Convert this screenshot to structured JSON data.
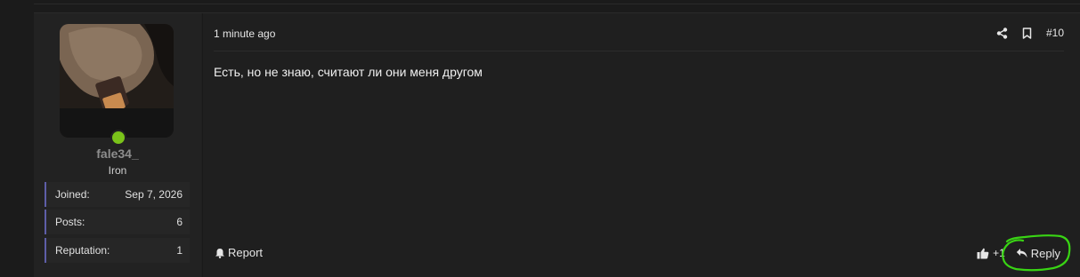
{
  "post": {
    "time": "1 minute ago",
    "number": "#10",
    "message": "Есть, но не знаю, считают ли они меня другом",
    "report_label": "Report",
    "like_count": "+1",
    "reply_label": "Reply"
  },
  "user": {
    "name": "fale34_",
    "rank": "Iron",
    "online_color": "#7ac31a",
    "stats": [
      {
        "label": "Joined:",
        "value": "Sep 7, 2026"
      },
      {
        "label": "Posts:",
        "value": "6"
      },
      {
        "label": "Reputation:",
        "value": "1"
      }
    ]
  },
  "icons": {
    "share": "share-icon",
    "bookmark": "bookmark-icon",
    "bell": "bell-icon",
    "like": "thumbs-up-icon",
    "reply": "reply-arrow-icon"
  },
  "colors": {
    "accent_border": "#5e5ea8",
    "highlight": "#39d414"
  }
}
